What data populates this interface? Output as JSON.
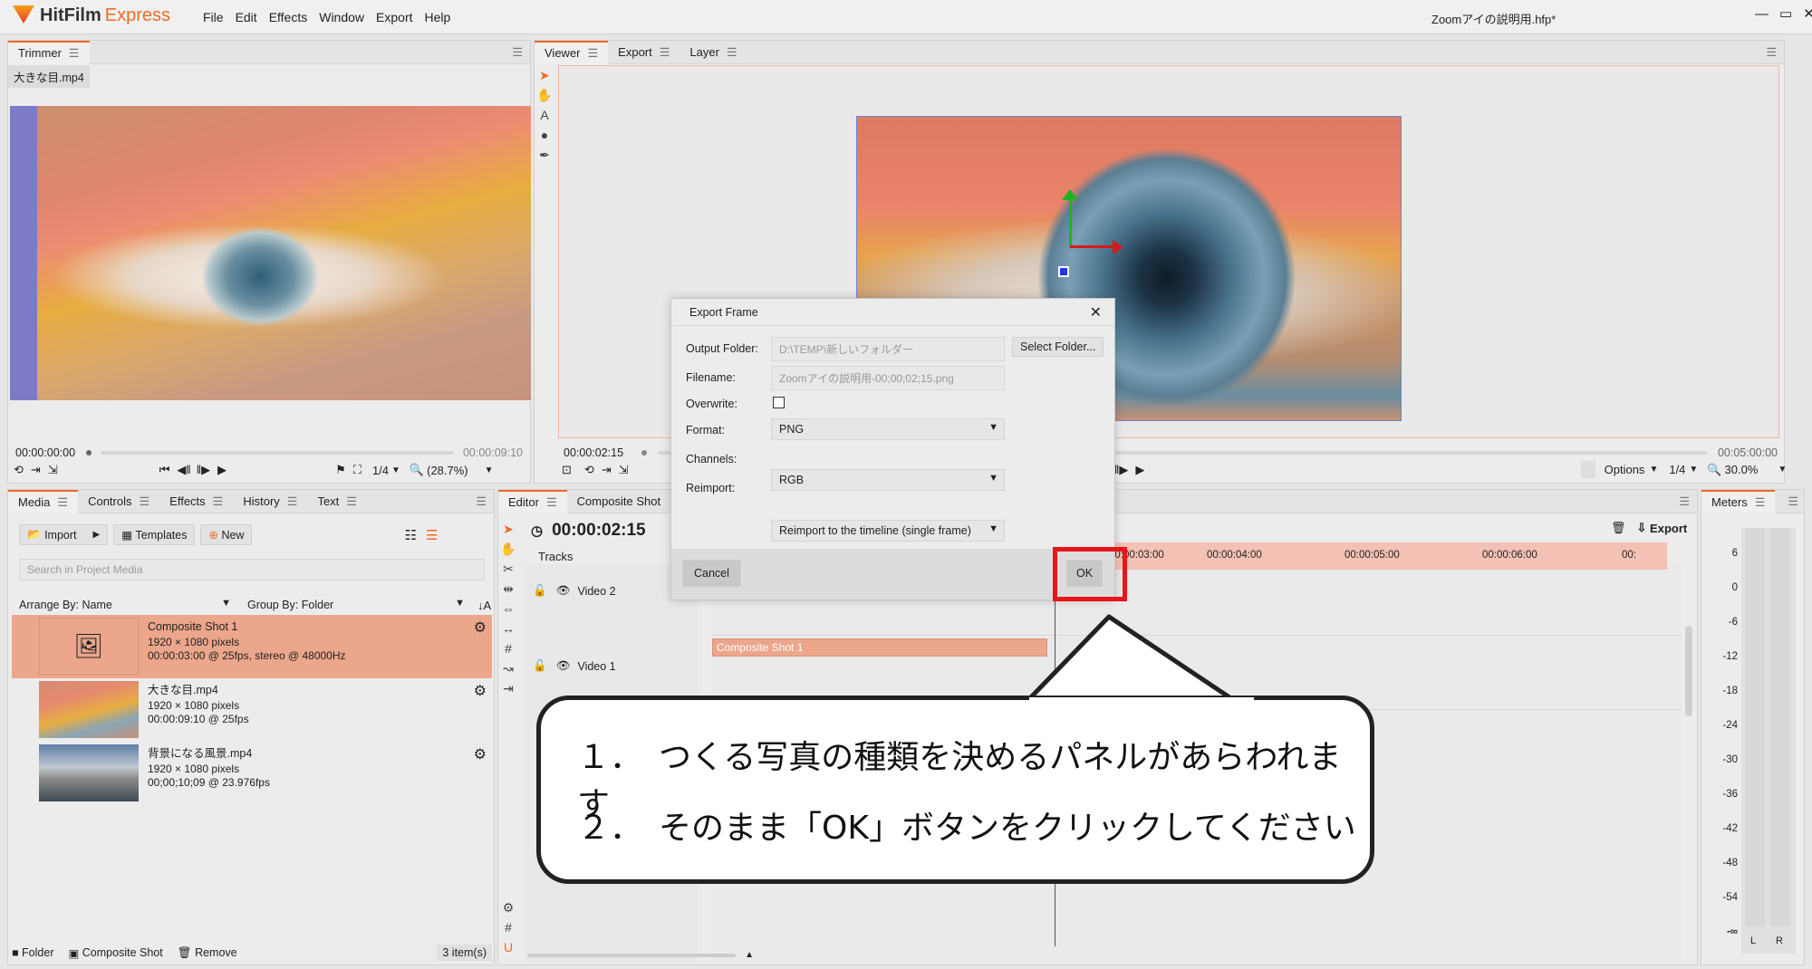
{
  "app": {
    "name": "HitFilm",
    "edition": "Express",
    "menus": [
      "File",
      "Edit",
      "Effects",
      "Window",
      "Export",
      "Help"
    ],
    "document_title": "Zoomアイの説明用.hfp*",
    "window_controls": [
      "—",
      "▭",
      "✕"
    ]
  },
  "trimmer": {
    "tab": "Trimmer",
    "file_tab": "大きな目.mp4",
    "time_start": "00:00:00:00",
    "time_end": "00:00:09:10",
    "ratio": "1/4",
    "zoom": "(28.7%)"
  },
  "viewer": {
    "tabs": [
      "Viewer",
      "Export",
      "Layer"
    ],
    "time_current": "00:00:02:15",
    "time_end": "00:05:00:00",
    "options_label": "Options",
    "ratio": "1/4",
    "zoom": "30.0%"
  },
  "media": {
    "tabs": [
      "Media",
      "Controls",
      "Effects",
      "History",
      "Text"
    ],
    "import_label": "Import",
    "templates_label": "Templates",
    "new_label": "New",
    "search_placeholder": "Search in Project Media",
    "arrange_label": "Arrange By: Name",
    "group_label": "Group By: Folder",
    "items": [
      {
        "title": "Composite Shot 1",
        "line1": "1920 × 1080 pixels",
        "line2": "00:00:03:00 @ 25fps, stereo @ 48000Hz"
      },
      {
        "title": "大きな目.mp4",
        "line1": "1920 × 1080 pixels",
        "line2": "00:00:09:10 @ 25fps"
      },
      {
        "title": "背景になる風景.mp4",
        "line1": "1920 × 1080 pixels",
        "line2": "00;00;10;09 @ 23.976fps"
      }
    ],
    "footer": {
      "folder": "Folder",
      "composite": "Composite Shot",
      "remove": "Remove",
      "count": "3 item(s)"
    }
  },
  "editor": {
    "tabs": [
      "Editor",
      "Composite Shot"
    ],
    "time": "00:00:02:15",
    "tracks_label": "Tracks",
    "export_label": "Export",
    "ruler": [
      "00:00:03:00",
      "00:00:04:00",
      "00:00:05:00",
      "00:00:06:00",
      "00:"
    ],
    "tracks": [
      {
        "name": "Video 2"
      },
      {
        "name": "Video 1"
      }
    ],
    "clip_label": "Composite Shot 1"
  },
  "meters": {
    "tab": "Meters",
    "scale": [
      "6",
      "0",
      "-6",
      "-12",
      "-18",
      "-24",
      "-30",
      "-36",
      "-42",
      "-48",
      "-54",
      "-∞"
    ],
    "channels": [
      "L",
      "R"
    ]
  },
  "dialog": {
    "title": "Export Frame",
    "output_folder_label": "Output Folder:",
    "output_folder_value": "D:\\TEMP\\新しいフォルダー",
    "select_folder_label": "Select Folder...",
    "filename_label": "Filename:",
    "filename_value": "Zoomアイの説明用-00;00;02;15.png",
    "overwrite_label": "Overwrite:",
    "format_label": "Format:",
    "format_value": "PNG",
    "channels_label": "Channels:",
    "channels_value": "RGB",
    "reimport_label": "Reimport:",
    "reimport_value": "Reimport to the timeline (single frame)",
    "cancel_label": "Cancel",
    "ok_label": "OK"
  },
  "callout": {
    "line1": "１．　つくる写真の種類を決めるパネルがあらわれます",
    "line2": "２．　そのまま「OK」ボタンをクリックしてください"
  },
  "colors": {
    "accent": "#f06a25",
    "selection": "#eba68c",
    "highlight_box": "#e8151a",
    "timeline_range": "#f4c2b4"
  }
}
